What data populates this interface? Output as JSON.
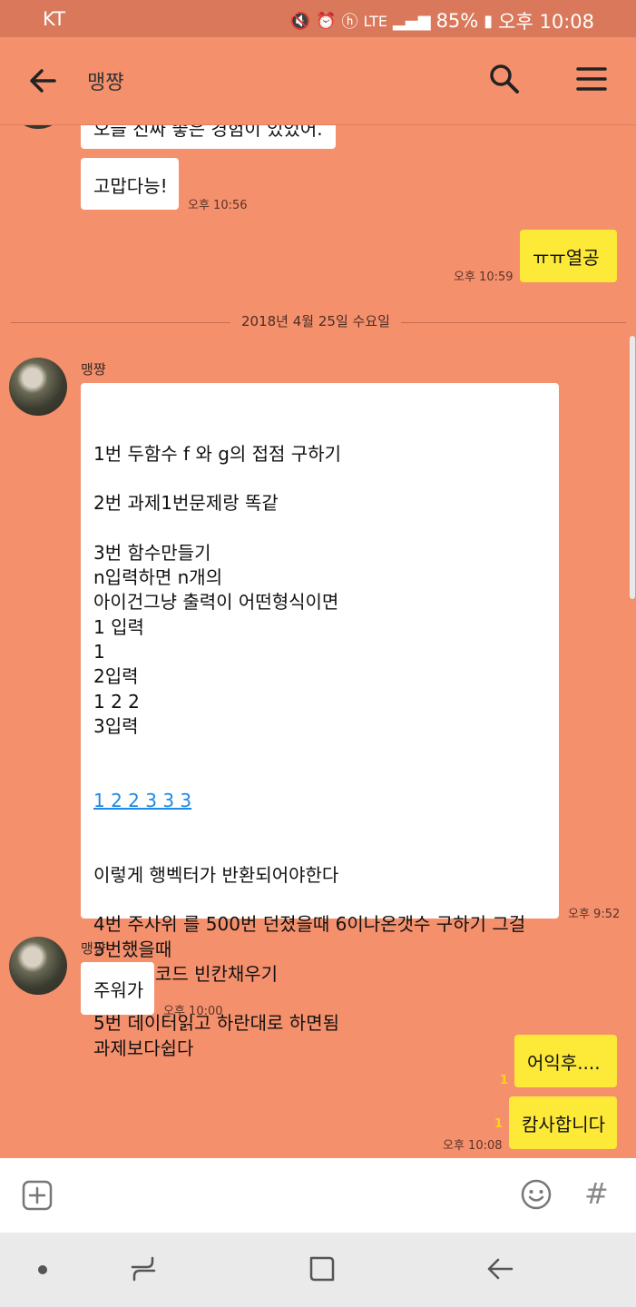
{
  "status_bar": {
    "carrier": "KT",
    "network": "LTE",
    "battery": "85%",
    "time": "오후 10:08"
  },
  "header": {
    "title": "맹쨩"
  },
  "messages": {
    "partial_text": "오늘 진짜 좋은 경험이 있었어.",
    "thanks": "고맙다능!",
    "thanks_time": "오후 10:56",
    "me_cry": "ㅠㅠ열공",
    "me_cry_time": "오후 10:59",
    "date_divider": "2018년 4월 25일 수요일",
    "sender1": "맹쨩",
    "long_lines": [
      "1번 두함수 f 와 g의 접점 구하기",
      "",
      "2번 과제1번문제랑 똑같",
      "",
      "3번 함수만들기",
      "n입력하면 n개의",
      "아이건그냥 출력이 어떤형식이면",
      "1 입력",
      "1",
      "2입력",
      "1 2 2",
      "3입력"
    ],
    "long_link": "1 2 2 3 3 3",
    "long_lines2": [
      "이렇게 행벡터가 반환되어야한다",
      "",
      "4번 주사위 를 500번 던졌을때 6이나온갯수 구하기 그걸",
      "5번했을때",
      "에 대한 코드 빈칸채우기",
      "",
      "5번 데이터읽고 하란대로 하면됨",
      "과제보다쉽다"
    ],
    "long_time": "오후 9:52",
    "sender2": "맹쨩",
    "hard": "주워가",
    "hard_time": "오후 10:00",
    "me1": "어익후....",
    "me1_unread": "1",
    "me2": "캄사합니다",
    "me2_unread": "1",
    "me2_time": "오후 10:08"
  },
  "icons": {
    "back": "arrow-left-icon",
    "search": "search-icon",
    "menu": "hamburger-menu-icon",
    "plus": "plus-box-icon",
    "emoji": "smiley-icon",
    "hash": "#"
  },
  "colors": {
    "background": "#f5906d",
    "my_bubble": "#fde938",
    "their_bubble": "#ffffff",
    "link": "#1e88e5"
  }
}
